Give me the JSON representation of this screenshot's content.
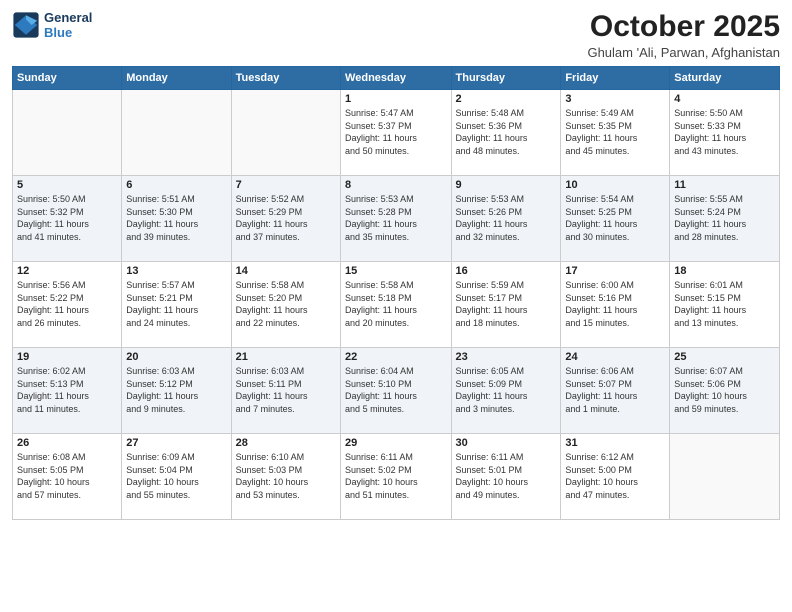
{
  "header": {
    "logo_line1": "General",
    "logo_line2": "Blue",
    "month": "October 2025",
    "location": "Ghulam 'Ali, Parwan, Afghanistan"
  },
  "weekdays": [
    "Sunday",
    "Monday",
    "Tuesday",
    "Wednesday",
    "Thursday",
    "Friday",
    "Saturday"
  ],
  "weeks": [
    [
      {
        "day": "",
        "content": ""
      },
      {
        "day": "",
        "content": ""
      },
      {
        "day": "",
        "content": ""
      },
      {
        "day": "1",
        "content": "Sunrise: 5:47 AM\nSunset: 5:37 PM\nDaylight: 11 hours\nand 50 minutes."
      },
      {
        "day": "2",
        "content": "Sunrise: 5:48 AM\nSunset: 5:36 PM\nDaylight: 11 hours\nand 48 minutes."
      },
      {
        "day": "3",
        "content": "Sunrise: 5:49 AM\nSunset: 5:35 PM\nDaylight: 11 hours\nand 45 minutes."
      },
      {
        "day": "4",
        "content": "Sunrise: 5:50 AM\nSunset: 5:33 PM\nDaylight: 11 hours\nand 43 minutes."
      }
    ],
    [
      {
        "day": "5",
        "content": "Sunrise: 5:50 AM\nSunset: 5:32 PM\nDaylight: 11 hours\nand 41 minutes."
      },
      {
        "day": "6",
        "content": "Sunrise: 5:51 AM\nSunset: 5:30 PM\nDaylight: 11 hours\nand 39 minutes."
      },
      {
        "day": "7",
        "content": "Sunrise: 5:52 AM\nSunset: 5:29 PM\nDaylight: 11 hours\nand 37 minutes."
      },
      {
        "day": "8",
        "content": "Sunrise: 5:53 AM\nSunset: 5:28 PM\nDaylight: 11 hours\nand 35 minutes."
      },
      {
        "day": "9",
        "content": "Sunrise: 5:53 AM\nSunset: 5:26 PM\nDaylight: 11 hours\nand 32 minutes."
      },
      {
        "day": "10",
        "content": "Sunrise: 5:54 AM\nSunset: 5:25 PM\nDaylight: 11 hours\nand 30 minutes."
      },
      {
        "day": "11",
        "content": "Sunrise: 5:55 AM\nSunset: 5:24 PM\nDaylight: 11 hours\nand 28 minutes."
      }
    ],
    [
      {
        "day": "12",
        "content": "Sunrise: 5:56 AM\nSunset: 5:22 PM\nDaylight: 11 hours\nand 26 minutes."
      },
      {
        "day": "13",
        "content": "Sunrise: 5:57 AM\nSunset: 5:21 PM\nDaylight: 11 hours\nand 24 minutes."
      },
      {
        "day": "14",
        "content": "Sunrise: 5:58 AM\nSunset: 5:20 PM\nDaylight: 11 hours\nand 22 minutes."
      },
      {
        "day": "15",
        "content": "Sunrise: 5:58 AM\nSunset: 5:18 PM\nDaylight: 11 hours\nand 20 minutes."
      },
      {
        "day": "16",
        "content": "Sunrise: 5:59 AM\nSunset: 5:17 PM\nDaylight: 11 hours\nand 18 minutes."
      },
      {
        "day": "17",
        "content": "Sunrise: 6:00 AM\nSunset: 5:16 PM\nDaylight: 11 hours\nand 15 minutes."
      },
      {
        "day": "18",
        "content": "Sunrise: 6:01 AM\nSunset: 5:15 PM\nDaylight: 11 hours\nand 13 minutes."
      }
    ],
    [
      {
        "day": "19",
        "content": "Sunrise: 6:02 AM\nSunset: 5:13 PM\nDaylight: 11 hours\nand 11 minutes."
      },
      {
        "day": "20",
        "content": "Sunrise: 6:03 AM\nSunset: 5:12 PM\nDaylight: 11 hours\nand 9 minutes."
      },
      {
        "day": "21",
        "content": "Sunrise: 6:03 AM\nSunset: 5:11 PM\nDaylight: 11 hours\nand 7 minutes."
      },
      {
        "day": "22",
        "content": "Sunrise: 6:04 AM\nSunset: 5:10 PM\nDaylight: 11 hours\nand 5 minutes."
      },
      {
        "day": "23",
        "content": "Sunrise: 6:05 AM\nSunset: 5:09 PM\nDaylight: 11 hours\nand 3 minutes."
      },
      {
        "day": "24",
        "content": "Sunrise: 6:06 AM\nSunset: 5:07 PM\nDaylight: 11 hours\nand 1 minute."
      },
      {
        "day": "25",
        "content": "Sunrise: 6:07 AM\nSunset: 5:06 PM\nDaylight: 10 hours\nand 59 minutes."
      }
    ],
    [
      {
        "day": "26",
        "content": "Sunrise: 6:08 AM\nSunset: 5:05 PM\nDaylight: 10 hours\nand 57 minutes."
      },
      {
        "day": "27",
        "content": "Sunrise: 6:09 AM\nSunset: 5:04 PM\nDaylight: 10 hours\nand 55 minutes."
      },
      {
        "day": "28",
        "content": "Sunrise: 6:10 AM\nSunset: 5:03 PM\nDaylight: 10 hours\nand 53 minutes."
      },
      {
        "day": "29",
        "content": "Sunrise: 6:11 AM\nSunset: 5:02 PM\nDaylight: 10 hours\nand 51 minutes."
      },
      {
        "day": "30",
        "content": "Sunrise: 6:11 AM\nSunset: 5:01 PM\nDaylight: 10 hours\nand 49 minutes."
      },
      {
        "day": "31",
        "content": "Sunrise: 6:12 AM\nSunset: 5:00 PM\nDaylight: 10 hours\nand 47 minutes."
      },
      {
        "day": "",
        "content": ""
      }
    ]
  ]
}
